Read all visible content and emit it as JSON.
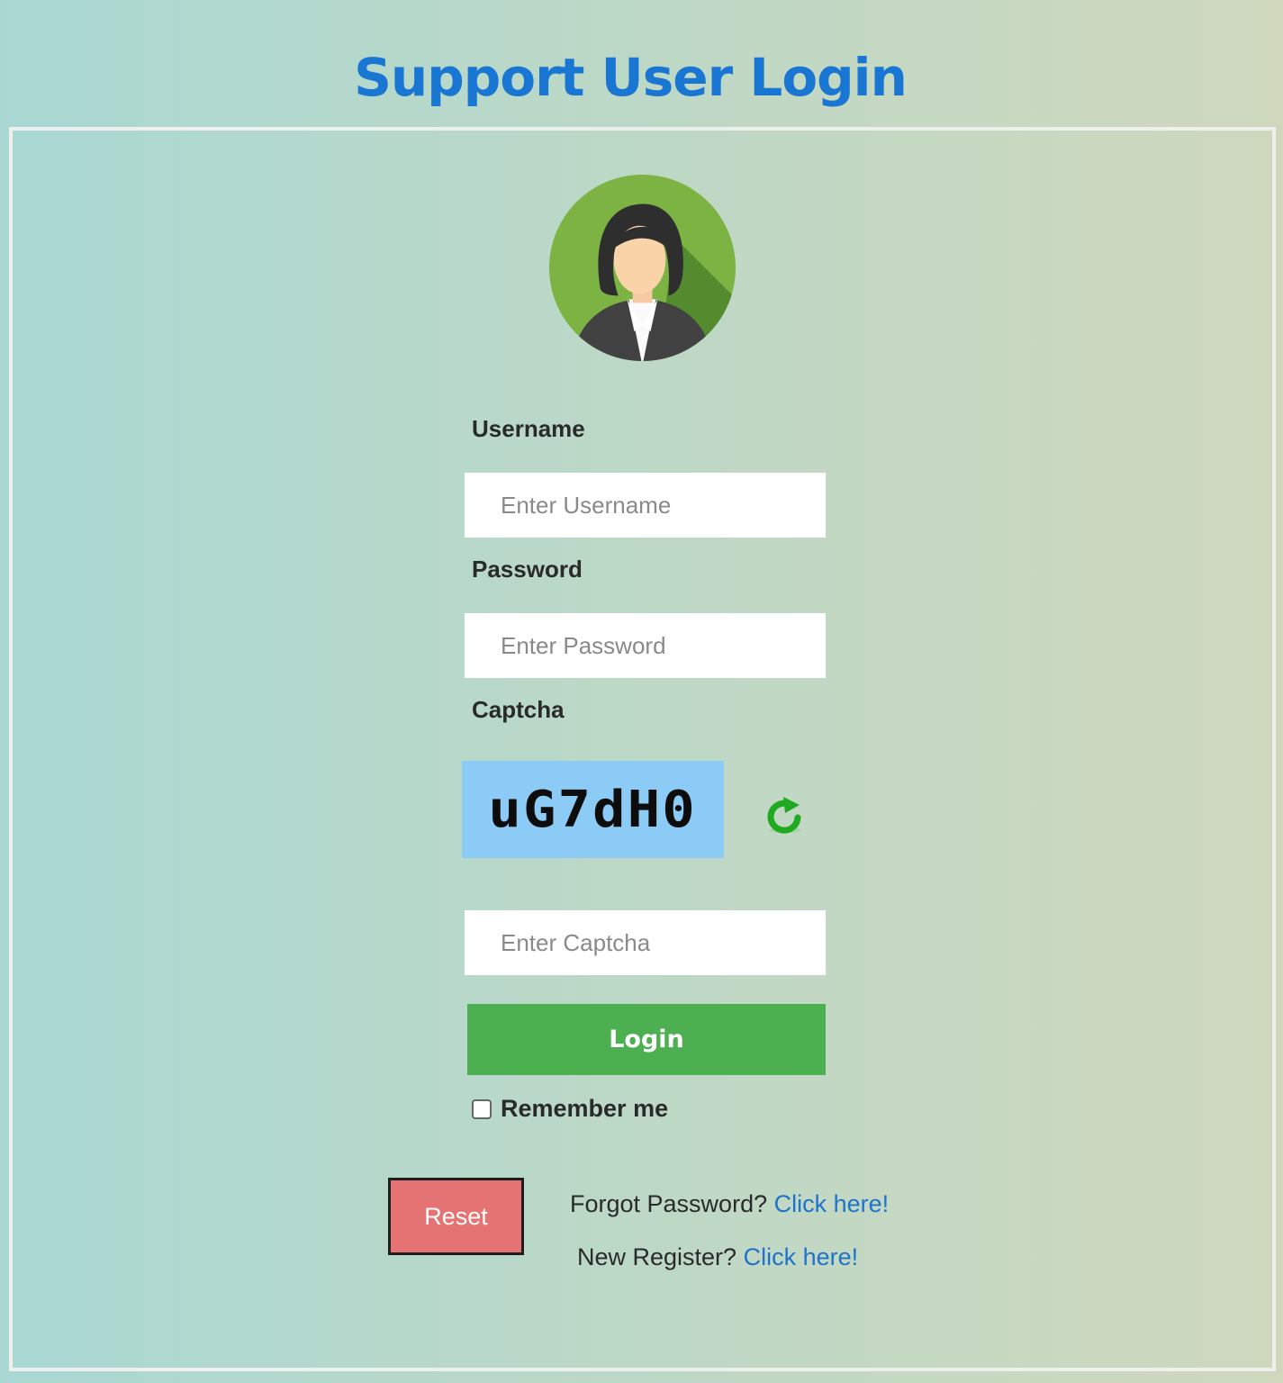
{
  "header": {
    "title": "Support User Login"
  },
  "avatar": {
    "icon": "female-user-avatar-icon",
    "circle_color": "#7cb342"
  },
  "form": {
    "username": {
      "label": "Username",
      "placeholder": "Enter Username",
      "value": ""
    },
    "password": {
      "label": "Password",
      "placeholder": "Enter Password",
      "value": ""
    },
    "captcha": {
      "label": "Captcha",
      "code": "uG7dH0",
      "refresh_icon": "refresh-icon",
      "placeholder": "Enter Captcha",
      "value": ""
    },
    "login_button": "Login",
    "remember_me": {
      "label": "Remember me",
      "checked": false
    },
    "reset_button": "Reset"
  },
  "links": {
    "forgot_prompt": "Forgot Password?",
    "forgot_link": "Click here!",
    "register_prompt": "New Register?",
    "register_link": "Click here!"
  },
  "colors": {
    "title": "#1976d2",
    "login_button": "#4caf50",
    "reset_button": "#e57373",
    "link": "#1f73c9",
    "captcha_background": "#8ccbf5"
  }
}
